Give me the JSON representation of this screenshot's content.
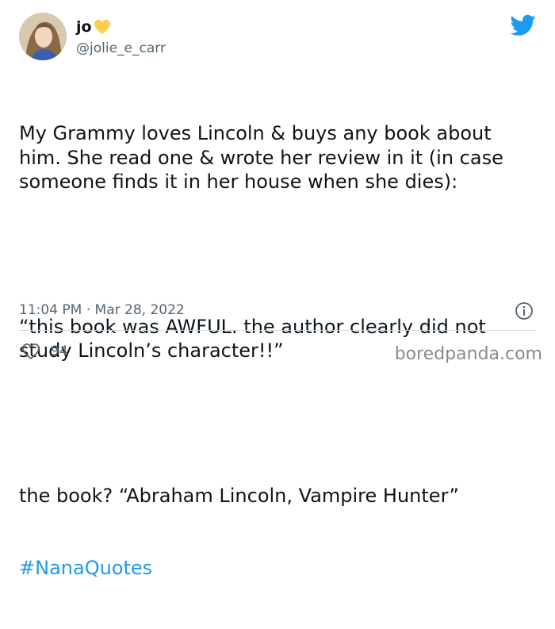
{
  "user": {
    "display_name": "jo",
    "handle": "@jolie_e_carr",
    "heart_icon": "yellow-heart-icon",
    "avatar_icon": "avatar-photo"
  },
  "tweet": {
    "paragraph_1": "My Grammy loves Lincoln & buys any book about him. She read one & wrote her review in it (in case someone finds it in her house when she dies):",
    "paragraph_2": "“this book was AWFUL. the author clearly did not study Lincoln’s character!!”",
    "paragraph_3": "the book? “Abraham Lincoln, Vampire Hunter”",
    "hashtag": "#NanaQuotes"
  },
  "meta": {
    "timestamp": "11:04 PM · Mar 28, 2022",
    "info_icon": "info-icon"
  },
  "engagement": {
    "likes": "94",
    "like_icon": "heart-outline-icon"
  },
  "brand": {
    "twitter_icon": "twitter-bird-icon",
    "watermark": "boredpanda.com"
  },
  "colors": {
    "link": "#1d9bf0",
    "text": "#0f1419",
    "secondary": "#536471",
    "heart": "#ffcc4d"
  }
}
